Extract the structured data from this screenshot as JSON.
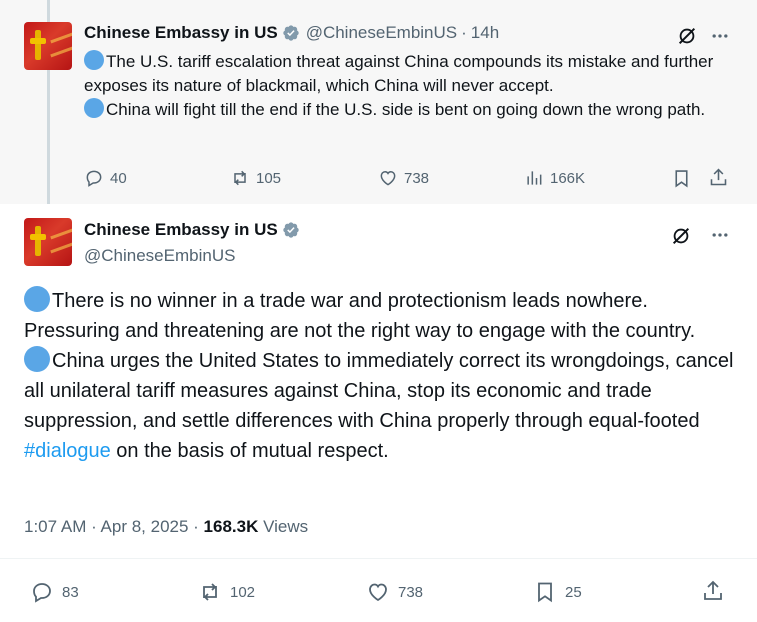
{
  "tweet1": {
    "name": "Chinese Embassy in US",
    "handle": "@ChineseEmbinUS",
    "separator": "·",
    "time": "14h",
    "para1": "The U.S. tariff escalation threat against China compounds its mistake and further exposes its nature of blackmail, which China will never accept.",
    "para2": "China will fight till the end if the U.S. side is bent on going down the wrong path.",
    "replies": "40",
    "reposts": "105",
    "likes": "738",
    "views": "166K"
  },
  "tweet2": {
    "name": "Chinese Embassy in US",
    "handle": "@ChineseEmbinUS",
    "para1": "There is no winner in a trade war and protectionism leads nowhere. Pressuring and threatening are not the right way to engage with the country.",
    "para2_before": "China urges the United States to immediately correct its wrongdoings, cancel all unilateral tariff measures against China, stop its economic and trade suppression, and settle differences with China properly through equal-footed ",
    "hashtag": "#dialogue",
    "para2_after": " on the basis of mutual respect.",
    "timestamp": "1:07 AM · Apr 8, 2025 · ",
    "views_count": "168.3K",
    "views_label": " Views",
    "replies": "83",
    "reposts": "102",
    "likes": "738",
    "bookmarks": "25"
  },
  "colors": {
    "accent": "#1d9bf0",
    "muted": "#536471",
    "verified": "#829aab",
    "bullet": "#5aa6e6"
  },
  "icons": [
    "verified-badge-icon",
    "grok-icon",
    "more-icon",
    "reply-icon",
    "repost-icon",
    "like-icon",
    "views-icon",
    "bookmark-icon",
    "share-icon",
    "blue-circle-emoji"
  ]
}
